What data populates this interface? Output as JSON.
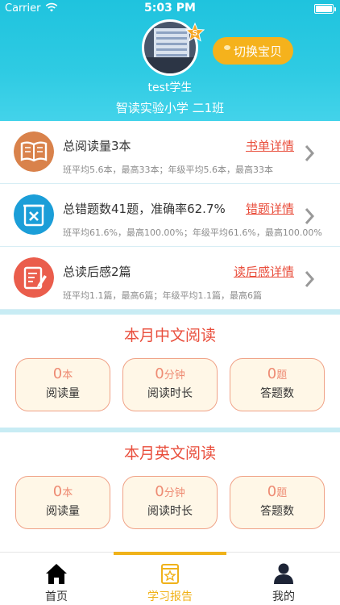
{
  "status_bar": {
    "carrier": "Carrier",
    "time": "5:03 PM"
  },
  "header": {
    "student_name": "test学生",
    "school_class": "智读实验小学 二1班",
    "switch_button": "切换宝贝"
  },
  "stats": [
    {
      "title": "总阅读量3本",
      "subtitle": "班平均5.6本，最高33本；年级平均5.6本，最高33本",
      "link": "书单详情",
      "icon": "book-icon",
      "color": "#d9824b"
    },
    {
      "title": "总错题数41题，准确率62.7%",
      "subtitle": "班平均61.6%，最高100.00%；年级平均61.6%，最高100.00%",
      "link": "错题详情",
      "icon": "wrong-answer-icon",
      "color": "#1b9ed8"
    },
    {
      "title": "总读后感2篇",
      "subtitle": "班平均1.1篇，最高6篇；年级平均1.1篇，最高6篇",
      "link": "读后感详情",
      "icon": "notes-icon",
      "color": "#ea5d4c"
    }
  ],
  "chinese_reading": {
    "title": "本月中文阅读",
    "cards": [
      {
        "value": "0",
        "unit": "本",
        "label": "阅读量"
      },
      {
        "value": "0",
        "unit": "分钟",
        "label": "阅读时长"
      },
      {
        "value": "0",
        "unit": "题",
        "label": "答题数"
      }
    ]
  },
  "english_reading": {
    "title": "本月英文阅读",
    "cards": [
      {
        "value": "0",
        "unit": "本",
        "label": "阅读量"
      },
      {
        "value": "0",
        "unit": "分钟",
        "label": "阅读时长"
      },
      {
        "value": "0",
        "unit": "题",
        "label": "答题数"
      }
    ]
  },
  "tabbar": {
    "items": [
      {
        "label": "首页",
        "icon": "home-icon"
      },
      {
        "label": "学习报告",
        "icon": "report-icon",
        "active": true
      },
      {
        "label": "我的",
        "icon": "profile-icon"
      }
    ]
  },
  "colors": {
    "accent": "#f0b21a",
    "header": "#1fc3de",
    "link": "#e94e3c"
  }
}
